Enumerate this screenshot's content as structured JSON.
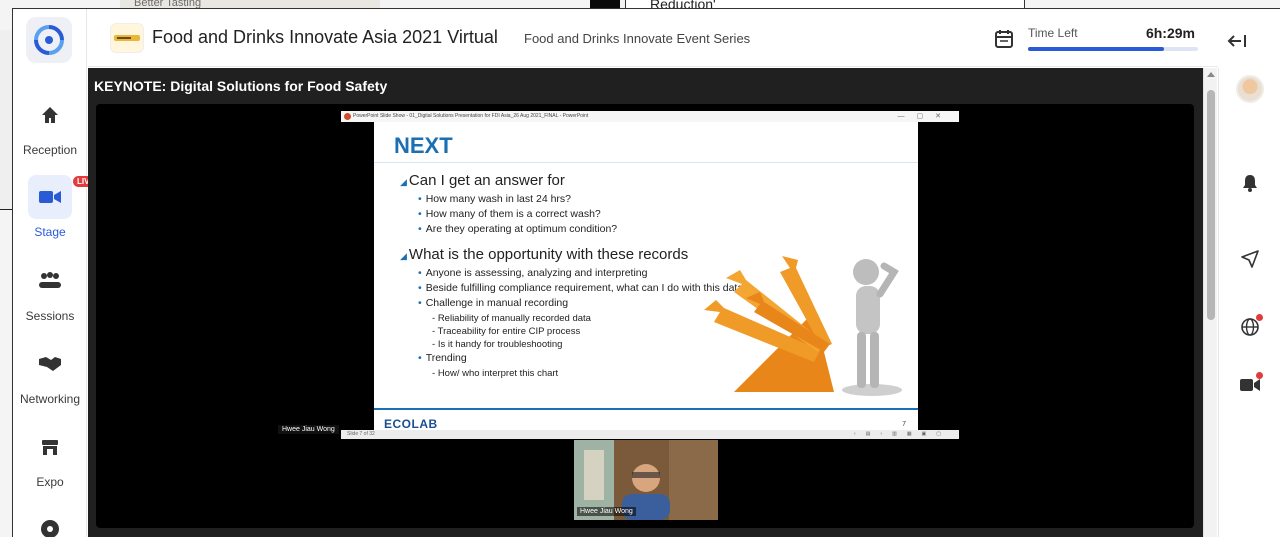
{
  "background": {
    "left_strip_text": "Better Tasting",
    "right_strip_text": "Reduction'"
  },
  "nav": {
    "items": [
      {
        "label": "Reception",
        "icon": "home-icon"
      },
      {
        "label": "Stage",
        "icon": "video-camera-icon",
        "badge": "LIVE",
        "active": true
      },
      {
        "label": "Sessions",
        "icon": "people-group-icon"
      },
      {
        "label": "Networking",
        "icon": "handshake-icon"
      },
      {
        "label": "Expo",
        "icon": "store-icon"
      },
      {
        "label": "",
        "icon": "more-icon"
      }
    ]
  },
  "header": {
    "event_title": "Food and Drinks Innovate Asia 2021 Virtual",
    "event_series": "Food and Drinks Innovate Event Series",
    "time_left_label": "Time Left",
    "time_left_value": "6h:29m",
    "time_progress": 0.8
  },
  "stage": {
    "title": "KEYNOTE: Digital Solutions for Food Safety",
    "ppt_window_title": "PowerPoint Slide Show  -  01_Digital Solutions Presentation for FDI Asia_26 Aug 2021_FINAL  -  PowerPoint",
    "slide": {
      "title": "NEXT",
      "q1": "Can I get an answer for",
      "q1_bullets": [
        "How many wash in last 24 hrs?",
        "How many of them is a correct wash?",
        "Are they operating at optimum condition?"
      ],
      "q2": "What is the opportunity with these records",
      "q2_bullets": [
        "Anyone is assessing, analyzing and interpreting",
        "Beside fulfilling compliance requirement, what can I do with this data?",
        "Challenge in manual recording"
      ],
      "sub_bullets": [
        "Reliability of manually recorded data",
        "Traceability for entire CIP process",
        "Is it handy for troubleshooting"
      ],
      "trending": "Trending",
      "trending_sub": "How/ who interpret this chart",
      "brand": "ECOLAB",
      "number": "7"
    },
    "slide_counter": "Slide 7 of 32",
    "speaker_name_tag": "Hwee Jiau Wong",
    "camera_name": "Hwee Jiau Wong"
  },
  "colors": {
    "accent": "#2a5bd7",
    "live": "#e23b3b",
    "slide_blue": "#1b6fb3"
  }
}
